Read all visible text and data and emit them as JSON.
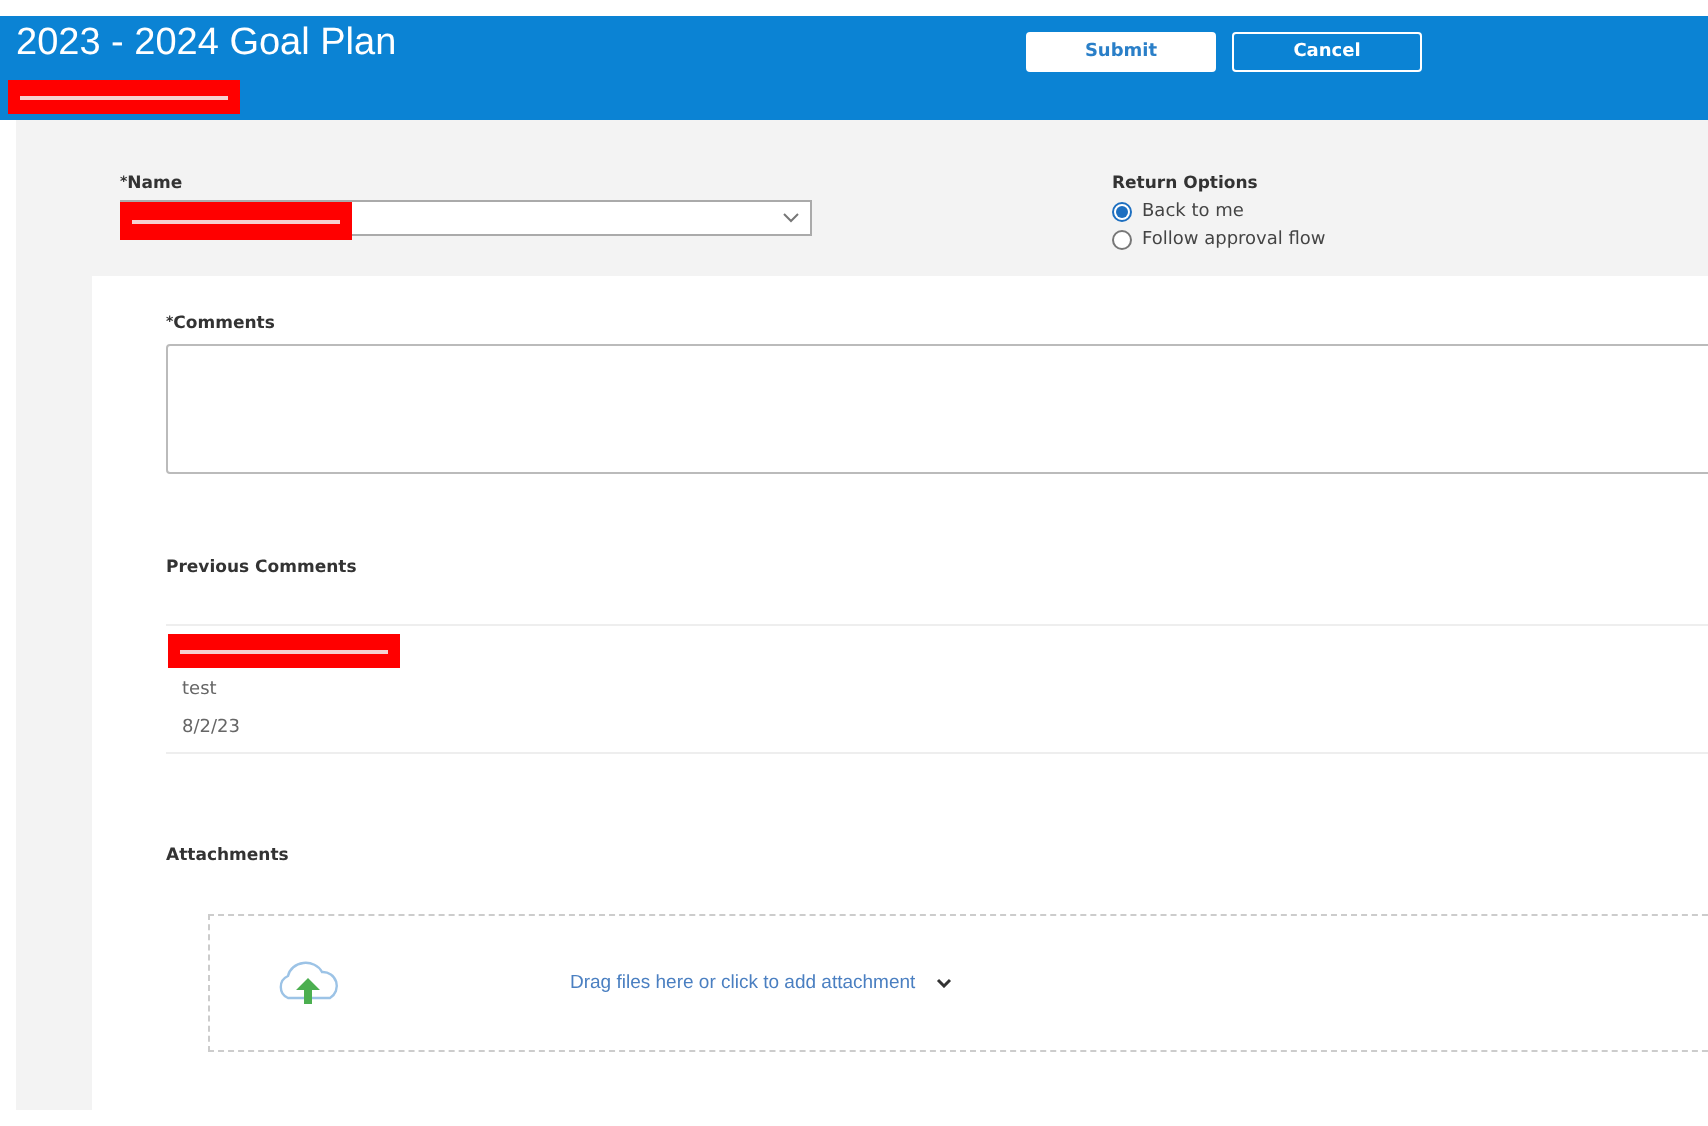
{
  "header": {
    "title": "2023 - 2024 Goal Plan",
    "subtitle": {
      "redacted": true
    },
    "buttons": [
      {
        "label": "Submit",
        "kind": "primary"
      },
      {
        "label": "Cancel",
        "kind": "secondary"
      }
    ]
  },
  "name_field": {
    "marker": "*",
    "label": "Name",
    "redacted": true
  },
  "return_options": {
    "label": "Return Options",
    "options": [
      {
        "label": "Back to me",
        "selected": true
      },
      {
        "label": "Follow approval flow",
        "selected": false
      }
    ]
  },
  "comments": {
    "marker": "*",
    "label": "Comments"
  },
  "previous_comments": {
    "title": "Previous Comments",
    "items": [
      {
        "author": {
          "redacted": true
        },
        "text": "test",
        "date": "8/2/23"
      }
    ]
  },
  "attachments": {
    "title": "Attachments",
    "dropzone_text": "Drag files here or click to add attachment"
  }
}
